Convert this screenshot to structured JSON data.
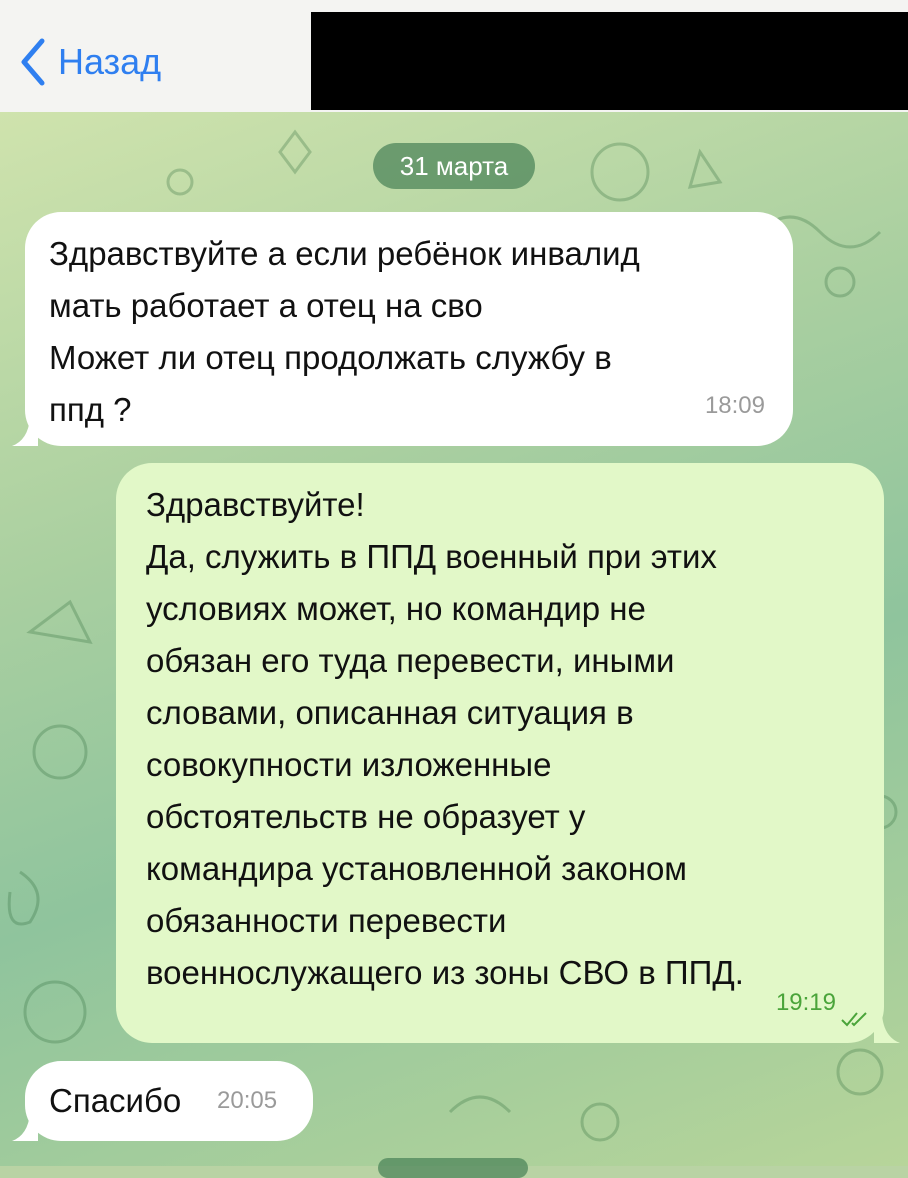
{
  "header": {
    "back_label": "Назад"
  },
  "chat": {
    "date_separator": "31 марта",
    "messages": [
      {
        "direction": "incoming",
        "text": "Здравствуйте а если ребёнок инвалид\nмать работает а отец на сво\nМожет ли отец продолжать службу в\nппд ?",
        "time": "18:09"
      },
      {
        "direction": "outgoing",
        "text": "Здравствуйте!\nДа, служить в ППД военный при этих\nусловиях может, но командир не\nобязан его туда перевести, иными\nсловами, описанная ситуация в\nсовокупности изложенные\nобстоятельств не образует у\nкомандира установленной законом\nобязанности перевести\nвоеннослужащего из зоны СВО в ППД.",
        "time": "19:19",
        "status": "read"
      },
      {
        "direction": "incoming",
        "text": "Спасибо",
        "time": "20:05"
      }
    ]
  },
  "colors": {
    "accent": "#2f7ff0",
    "incoming_bubble": "#ffffff",
    "outgoing_bubble": "#e2f8c8",
    "outgoing_time": "#4aa43a"
  },
  "icons": {
    "back": "chevron-left-icon",
    "read_status": "double-check-icon"
  }
}
